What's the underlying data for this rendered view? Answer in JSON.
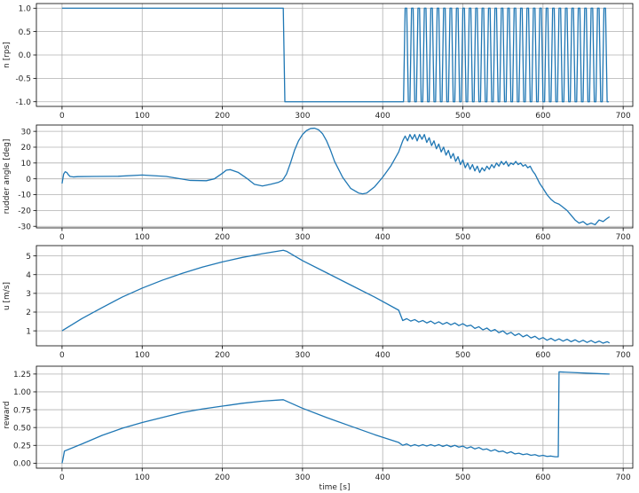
{
  "figure": {
    "series_color": "#1f77b4"
  },
  "chart_data": [
    {
      "type": "line",
      "title": "",
      "xlabel": "",
      "ylabel": "n [rps]",
      "xlim": [
        -32,
        712
      ],
      "ylim": [
        -1.1,
        1.1
      ],
      "xticks": [
        "0",
        "100",
        "200",
        "300",
        "400",
        "500",
        "600",
        "700"
      ],
      "yticks": [
        "1.0",
        "0.5",
        "0.0",
        "-0.5",
        "-1.0"
      ],
      "grid": true,
      "series": [
        {
          "x": [
            0,
            276,
            278,
            425,
            426,
            428,
            430,
            432,
            434,
            436,
            438,
            440,
            442,
            444,
            446,
            448,
            450,
            452,
            454,
            456,
            458,
            460,
            462,
            464,
            466,
            468,
            470,
            472,
            474,
            476,
            478,
            480,
            482,
            484,
            486,
            488,
            490,
            492,
            494,
            496,
            498,
            500,
            502,
            504,
            506,
            508,
            510,
            512,
            514,
            516,
            518,
            520,
            522,
            524,
            526,
            528,
            530,
            532,
            534,
            536,
            538,
            540,
            542,
            544,
            546,
            548,
            550,
            552,
            554,
            556,
            558,
            560,
            562,
            564,
            566,
            568,
            570,
            572,
            574,
            576,
            578,
            580,
            582,
            584,
            586,
            588,
            590,
            592,
            594,
            596,
            598,
            600,
            602,
            604,
            606,
            608,
            610,
            612,
            614,
            616,
            618,
            620,
            622,
            624,
            626,
            628,
            630,
            632,
            634,
            636,
            638,
            640,
            642,
            644,
            646,
            648,
            650,
            652,
            654,
            656,
            658,
            660,
            662,
            664,
            666,
            668,
            670,
            672,
            674,
            676,
            678,
            680,
            682
          ],
          "y": [
            1,
            1,
            -1,
            -1,
            -1,
            1,
            1,
            -1,
            -1,
            1,
            1,
            -1,
            -1,
            1,
            1,
            -1,
            -1,
            1,
            1,
            -1,
            -1,
            1,
            1,
            -1,
            -1,
            1,
            1,
            -1,
            -1,
            1,
            1,
            -1,
            -1,
            1,
            1,
            -1,
            -1,
            1,
            1,
            -1,
            -1,
            1,
            1,
            -1,
            -1,
            1,
            1,
            -1,
            -1,
            1,
            1,
            -1,
            -1,
            1,
            1,
            -1,
            -1,
            1,
            1,
            -1,
            -1,
            1,
            1,
            -1,
            -1,
            1,
            1,
            -1,
            -1,
            1,
            1,
            -1,
            -1,
            1,
            1,
            -1,
            -1,
            1,
            1,
            -1,
            -1,
            1,
            1,
            -1,
            -1,
            1,
            1,
            -1,
            -1,
            1,
            1,
            -1,
            -1,
            1,
            1,
            -1,
            -1,
            1,
            1,
            -1,
            -1,
            1,
            1,
            -1,
            -1,
            1,
            1,
            -1,
            -1,
            1,
            1,
            -1,
            -1,
            1,
            1,
            -1,
            -1,
            1,
            1,
            -1,
            -1,
            1,
            1,
            -1,
            -1,
            1,
            1,
            -1,
            -1,
            1,
            1,
            -1,
            -1
          ]
        }
      ]
    },
    {
      "type": "line",
      "title": "",
      "xlabel": "",
      "ylabel": "rudder angle [deg]",
      "xlim": [
        -32,
        712
      ],
      "ylim": [
        -31,
        34
      ],
      "xticks": [
        "0",
        "100",
        "200",
        "300",
        "400",
        "500",
        "600",
        "700"
      ],
      "yticks": [
        "30",
        "20",
        "10",
        "0",
        "-10",
        "-20",
        "-30"
      ],
      "grid": true,
      "series": [
        {
          "x": [
            0,
            2,
            4,
            6,
            8,
            10,
            14,
            20,
            40,
            70,
            100,
            130,
            160,
            180,
            190,
            200,
            205,
            210,
            220,
            230,
            240,
            250,
            260,
            270,
            275,
            280,
            285,
            290,
            295,
            300,
            305,
            310,
            315,
            320,
            325,
            330,
            335,
            340,
            350,
            360,
            370,
            375,
            380,
            390,
            400,
            410,
            420,
            425,
            428,
            431,
            434,
            437,
            440,
            443,
            446,
            449,
            452,
            455,
            458,
            461,
            464,
            467,
            470,
            473,
            476,
            479,
            482,
            485,
            488,
            491,
            494,
            497,
            500,
            503,
            506,
            509,
            512,
            515,
            518,
            521,
            524,
            527,
            530,
            533,
            536,
            539,
            542,
            545,
            548,
            551,
            554,
            557,
            560,
            563,
            566,
            569,
            572,
            575,
            578,
            581,
            584,
            587,
            590,
            593,
            596,
            600,
            605,
            610,
            615,
            620,
            625,
            630,
            635,
            640,
            645,
            650,
            655,
            660,
            665,
            670,
            675,
            680,
            683
          ],
          "y": [
            -3,
            3,
            4.5,
            4,
            2.5,
            1.5,
            1.2,
            1.4,
            1.5,
            1.6,
            2.4,
            1.5,
            -1,
            -1.2,
            0,
            3.5,
            5.5,
            5.8,
            4,
            0.5,
            -3.5,
            -4.5,
            -3.5,
            -2.2,
            -1,
            3,
            10,
            18,
            24,
            28,
            30.5,
            31.8,
            32,
            31,
            28.5,
            24,
            18,
            11,
            1,
            -6,
            -9,
            -9.5,
            -9,
            -5,
            1,
            8,
            17,
            24,
            27,
            24,
            28,
            25,
            28,
            24,
            28,
            25,
            28,
            23,
            26,
            21,
            24,
            19,
            22,
            17,
            20,
            15,
            18,
            13,
            16,
            11,
            14,
            9,
            12,
            7,
            10,
            6,
            9,
            5,
            8,
            4,
            7,
            5,
            8,
            6,
            9,
            7,
            10,
            8,
            11,
            9,
            11,
            8,
            10,
            9,
            11,
            9,
            10,
            8,
            9,
            7,
            8,
            5,
            3,
            0,
            -3,
            -6,
            -10,
            -13,
            -15,
            -16,
            -18,
            -20,
            -23,
            -26,
            -28,
            -27,
            -29,
            -28,
            -29,
            -26,
            -27,
            -25,
            -24
          ]
        }
      ]
    },
    {
      "type": "line",
      "title": "",
      "xlabel": "",
      "ylabel": "u [m/s]",
      "xlim": [
        -32,
        712
      ],
      "ylim": [
        0.2,
        5.55
      ],
      "xticks": [
        "0",
        "100",
        "200",
        "300",
        "400",
        "500",
        "600",
        "700"
      ],
      "yticks": [
        "5",
        "4",
        "3",
        "2",
        "1"
      ],
      "grid": true,
      "series": [
        {
          "x": [
            0,
            25,
            50,
            75,
            100,
            125,
            150,
            175,
            200,
            225,
            250,
            276,
            280,
            300,
            330,
            360,
            390,
            420,
            425,
            430,
            435,
            440,
            445,
            450,
            455,
            460,
            465,
            470,
            475,
            480,
            485,
            490,
            495,
            500,
            505,
            510,
            515,
            520,
            525,
            530,
            535,
            540,
            545,
            550,
            555,
            560,
            565,
            570,
            575,
            580,
            585,
            590,
            595,
            600,
            605,
            610,
            615,
            620,
            625,
            630,
            635,
            640,
            645,
            650,
            655,
            660,
            665,
            670,
            675,
            680,
            683
          ],
          "y": [
            1.0,
            1.66,
            2.24,
            2.8,
            3.28,
            3.7,
            4.07,
            4.4,
            4.68,
            4.92,
            5.12,
            5.3,
            5.25,
            4.75,
            4.1,
            3.45,
            2.8,
            2.1,
            1.55,
            1.65,
            1.52,
            1.6,
            1.47,
            1.55,
            1.42,
            1.52,
            1.38,
            1.48,
            1.35,
            1.45,
            1.32,
            1.42,
            1.28,
            1.38,
            1.25,
            1.3,
            1.13,
            1.22,
            1.05,
            1.15,
            0.98,
            1.07,
            0.9,
            1.0,
            0.82,
            0.92,
            0.75,
            0.85,
            0.68,
            0.78,
            0.62,
            0.71,
            0.55,
            0.64,
            0.5,
            0.6,
            0.47,
            0.57,
            0.45,
            0.55,
            0.42,
            0.52,
            0.4,
            0.5,
            0.38,
            0.48,
            0.36,
            0.45,
            0.34,
            0.42,
            0.35
          ]
        }
      ]
    },
    {
      "type": "line",
      "title": "",
      "xlabel": "time [s]",
      "ylabel": "reward",
      "xlim": [
        -32,
        712
      ],
      "ylim": [
        -0.07,
        1.36
      ],
      "xticks": [
        "0",
        "100",
        "200",
        "300",
        "400",
        "500",
        "600",
        "700"
      ],
      "yticks": [
        "1.25",
        "1.00",
        "0.75",
        "0.50",
        "0.25",
        "0.00"
      ],
      "grid": true,
      "series": [
        {
          "x": [
            0,
            1,
            3,
            25,
            50,
            75,
            100,
            125,
            150,
            175,
            200,
            225,
            250,
            276,
            280,
            300,
            330,
            360,
            390,
            420,
            425,
            430,
            435,
            440,
            445,
            450,
            455,
            460,
            465,
            470,
            475,
            480,
            485,
            490,
            495,
            500,
            505,
            510,
            515,
            520,
            525,
            530,
            535,
            540,
            545,
            550,
            555,
            560,
            565,
            570,
            575,
            580,
            585,
            590,
            595,
            600,
            605,
            610,
            615,
            619,
            620,
            621,
            640,
            660,
            683
          ],
          "y": [
            0.0,
            0.05,
            0.17,
            0.27,
            0.39,
            0.49,
            0.57,
            0.64,
            0.71,
            0.76,
            0.8,
            0.84,
            0.87,
            0.89,
            0.87,
            0.77,
            0.64,
            0.52,
            0.4,
            0.29,
            0.25,
            0.27,
            0.24,
            0.26,
            0.24,
            0.26,
            0.24,
            0.26,
            0.24,
            0.26,
            0.235,
            0.255,
            0.23,
            0.25,
            0.225,
            0.24,
            0.21,
            0.23,
            0.2,
            0.22,
            0.19,
            0.2,
            0.17,
            0.19,
            0.16,
            0.17,
            0.14,
            0.16,
            0.13,
            0.14,
            0.12,
            0.13,
            0.11,
            0.12,
            0.1,
            0.11,
            0.095,
            0.1,
            0.09,
            0.09,
            1.28,
            1.28,
            1.27,
            1.26,
            1.25
          ]
        }
      ]
    }
  ]
}
